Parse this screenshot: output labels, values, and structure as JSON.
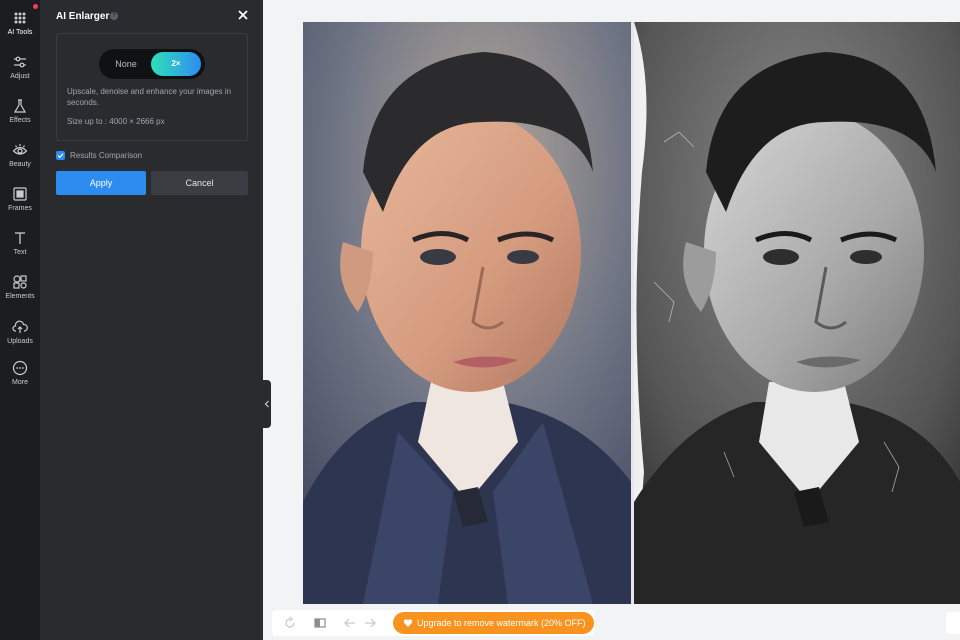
{
  "rail": {
    "items": [
      {
        "label": "AI Tools",
        "icon": "ai-tools-icon"
      },
      {
        "label": "Adjust",
        "icon": "sliders-icon"
      },
      {
        "label": "Effects",
        "icon": "flask-icon"
      },
      {
        "label": "Beauty",
        "icon": "eye-icon"
      },
      {
        "label": "Frames",
        "icon": "frame-icon"
      },
      {
        "label": "Text",
        "icon": "text-icon"
      },
      {
        "label": "Elements",
        "icon": "shapes-icon"
      },
      {
        "label": "Uploads",
        "icon": "upload-cloud-icon"
      },
      {
        "label": "More",
        "icon": "more-icon"
      }
    ]
  },
  "panel": {
    "title": "AI Enlarger",
    "help": "?",
    "toggle": {
      "none": "None",
      "two_x": "2×",
      "selected": "2×"
    },
    "description": "Upscale, denoise and enhance your images in seconds.",
    "size": "Size up to : 4000 × 2666 px",
    "comparison": {
      "label": "Results Comparison",
      "checked": true
    },
    "apply": "Apply",
    "cancel": "Cancel"
  },
  "toolbar": {
    "upgrade": "Upgrade to remove watermark (20% OFF)"
  },
  "colors": {
    "accent": "#2d8cf0",
    "toggle_gradient_start": "#2fe0b9",
    "upgrade_orange": "#f7931e",
    "panel_bg": "#2a2b2f",
    "rail_bg": "#1c1d20"
  }
}
